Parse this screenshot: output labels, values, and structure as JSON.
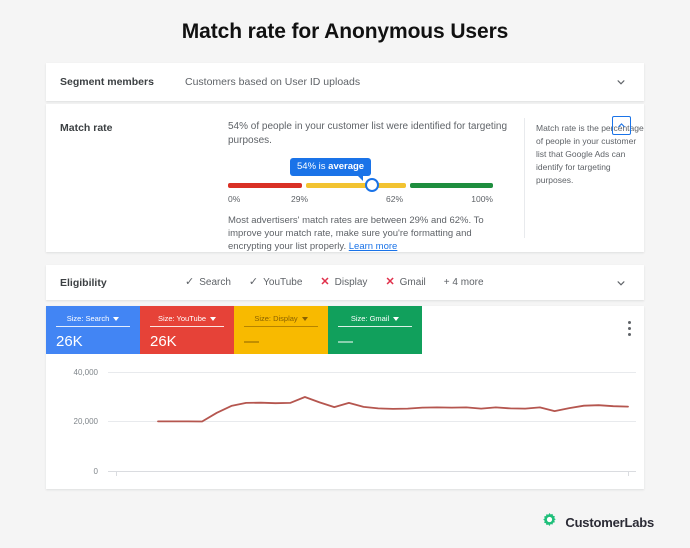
{
  "page": {
    "title": "Match rate for Anonymous Users",
    "background": "#f5f5f5"
  },
  "segment": {
    "label": "Segment members",
    "value": "Customers based on User ID uploads",
    "chevron_icon": "chevron-down-icon"
  },
  "match_rate": {
    "label": "Match rate",
    "description": "54% of people in your customer list were identified for targeting purposes.",
    "tooltip_prefix": "54% is ",
    "tooltip_strong": "average",
    "gauge": {
      "ticks": [
        "0%",
        "29%",
        "62%",
        "100%"
      ],
      "value_percent": 54,
      "red_color": "#d93025",
      "yellow_color": "#f2c331",
      "green_color": "#1e8e3e",
      "knob_color": "#1a73e8"
    },
    "note_text": "Most advertisers' match rates are between 29% and 62%. To improve your match rate, make sure you're formatting and encrypting your list properly. ",
    "note_link": "Learn more",
    "info_text": "Match rate is the percentage of people in your customer list that Google Ads can identify for targeting purposes.",
    "collapse_icon": "chevron-up-icon",
    "accent_color": "#1a73e8"
  },
  "eligibility": {
    "label": "Eligibility",
    "items": [
      {
        "name": "Search",
        "status": "eligible",
        "mark": "✓",
        "icon": "check-icon"
      },
      {
        "name": "YouTube",
        "status": "eligible",
        "mark": "✓",
        "icon": "check-icon"
      },
      {
        "name": "Display",
        "status": "ineligible",
        "mark": "✕",
        "icon": "cross-icon"
      },
      {
        "name": "Gmail",
        "status": "ineligible",
        "mark": "✕",
        "icon": "cross-icon"
      }
    ],
    "more_label": "+ 4 more",
    "chevron_icon": "chevron-down-icon"
  },
  "kpis": [
    {
      "label": "Size: Search",
      "value": "26K",
      "color": "#4285f4"
    },
    {
      "label": "Size: YouTube",
      "value": "26K",
      "color": "#e64238"
    },
    {
      "label": "Size: Display",
      "value": "—",
      "color": "#f8ba00"
    },
    {
      "label": "Size: Gmail",
      "value": "—",
      "color": "#11a05c"
    }
  ],
  "chart_menu_icon": "more-vertical-icon",
  "chart_data": {
    "type": "line",
    "title": "",
    "xlabel": "",
    "ylabel": "",
    "ylim": [
      0,
      40000
    ],
    "yticks": [
      0,
      20000,
      40000
    ],
    "ytick_labels": [
      "0",
      "20,000",
      "40,000"
    ],
    "grid": true,
    "legend": "none",
    "line_color": "#b5564f",
    "xtick_labels": [
      "",
      ""
    ],
    "xtick_note": "x-axis date labels are clipped by the card edge and unreadable",
    "series": [
      {
        "name": "Size",
        "values": [
          20050,
          20050,
          20050,
          20000,
          23500,
          26300,
          27500,
          27600,
          27400,
          27500,
          29900,
          27700,
          25800,
          27500,
          25900,
          25300,
          25100,
          25200,
          25600,
          25700,
          25600,
          25700,
          25200,
          25700,
          25300,
          25200,
          25700,
          24200,
          25400,
          26400,
          26600,
          26200,
          26000
        ]
      }
    ]
  },
  "footer": {
    "brand": "CustomerLabs",
    "logo_icon": "gear-icon",
    "logo_color": "#1fbf7a"
  }
}
